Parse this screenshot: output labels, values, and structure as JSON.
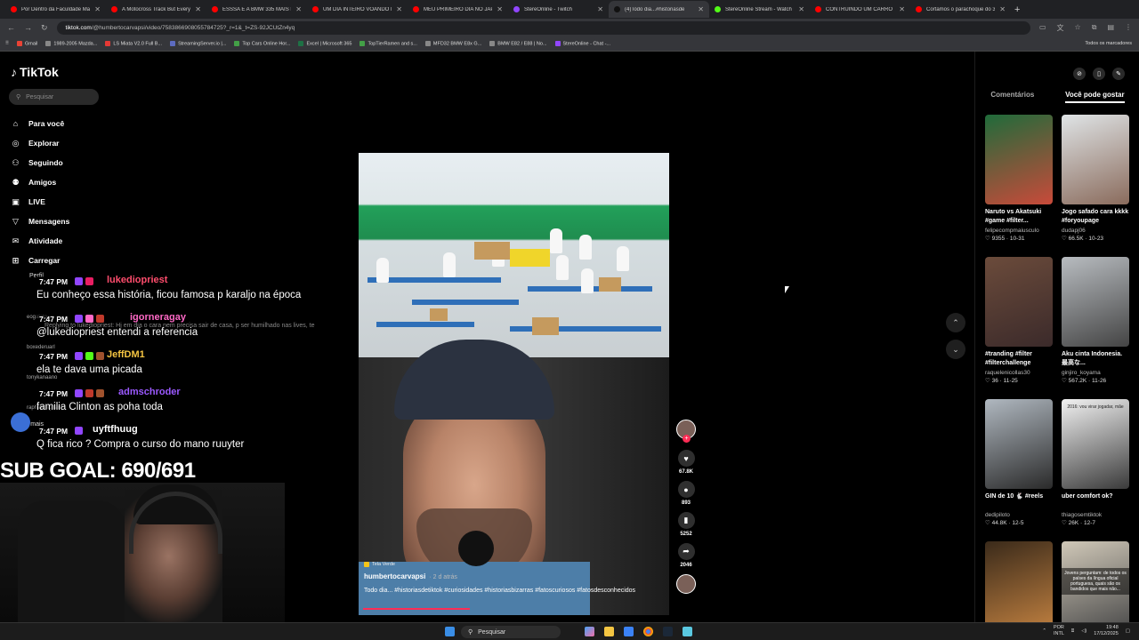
{
  "browser": {
    "tabs": [
      {
        "title": "Por Dentro da Faculdade Mai",
        "color": "#ff0000",
        "active": false
      },
      {
        "title": "A Motocross Track But Every",
        "color": "#ff0000",
        "active": false
      },
      {
        "title": "ESSSA É A BMW 335 MAIS LI",
        "color": "#ff0000",
        "active": false
      },
      {
        "title": "UM DIA INTEIRO VOANDO PI",
        "color": "#ff0000",
        "active": false
      },
      {
        "title": "MEU PRIMEIRO DIA NO JAPÃ",
        "color": "#ff0000",
        "active": false
      },
      {
        "title": "StereOnline - Twitch",
        "color": "#9146ff",
        "active": false
      },
      {
        "title": "(4)Todo dia...#historiasde",
        "color": "#111111",
        "active": true
      },
      {
        "title": "StereOnline Stream - Watch L",
        "color": "#53fc18",
        "active": false
      },
      {
        "title": "CONTRUINDO UM CARRO E",
        "color": "#ff0000",
        "active": false
      },
      {
        "title": "Cortamos o parachoque do 3",
        "color": "#ff0000",
        "active": false
      }
    ],
    "url_host": "tiktok.com",
    "url_path": "/@humbertocarvapsi/video/7583866908055784725?_r=1&_t=ZS-92JCUtZn4yq",
    "bookmarks": [
      {
        "label": "Gmail",
        "color": "#ea4335"
      },
      {
        "label": "1989-2005 Mazda...",
        "color": "#888888"
      },
      {
        "label": "LS Miata V2.0 Full B...",
        "color": "#e53935"
      },
      {
        "label": "StreamingServer.io |...",
        "color": "#5c6bc0"
      },
      {
        "label": "Top Cars Online Hor...",
        "color": "#43a047"
      },
      {
        "label": "Excel | Microsoft 365",
        "color": "#1e7145"
      },
      {
        "label": "TopTierRamen and s...",
        "color": "#43a047"
      },
      {
        "label": "MFD32 BMW E8x G...",
        "color": "#888888"
      },
      {
        "label": "BMW E82 / E88 | No...",
        "color": "#888888"
      },
      {
        "label": "StereOnline - Chat -...",
        "color": "#9146ff"
      }
    ],
    "all_bookmarks": "Todos os marcadores"
  },
  "tiktok": {
    "logo": "TikTok",
    "search_placeholder": "Pesquisar",
    "nav": [
      {
        "label": "Para você",
        "icon": "home-icon",
        "glyph": "⌂"
      },
      {
        "label": "Explorar",
        "icon": "compass-icon",
        "glyph": "◎"
      },
      {
        "label": "Seguindo",
        "icon": "following-icon",
        "glyph": "⚇"
      },
      {
        "label": "Amigos",
        "icon": "friends-icon",
        "glyph": "⚉"
      },
      {
        "label": "LIVE",
        "icon": "live-icon",
        "glyph": "▣"
      },
      {
        "label": "Mensagens",
        "icon": "messages-icon",
        "glyph": "▽"
      },
      {
        "label": "Atividade",
        "icon": "activity-icon",
        "glyph": "✉"
      },
      {
        "label": "Carregar",
        "icon": "upload-icon",
        "glyph": "⊞"
      }
    ],
    "perfil": "Perfil",
    "follow_list": [
      "eogalato",
      "boxederuarl",
      "tonykanaano",
      "raphaelbigham"
    ],
    "ver_mais": "Ver mais",
    "video": {
      "tag": "Tela Verde",
      "author": "humbertocarvapsi",
      "age": "· 2 d atrás",
      "caption": "Todo dia... #historiasdetiktok #curiosidades #historiasbizarras #fatoscuriosos #fatosdesconhecidos"
    },
    "actions": {
      "likes": "67.8K",
      "comments": "893",
      "saves": "5252",
      "shares": "2046"
    },
    "right_tabs": [
      "Comentários",
      "Você pode gostar"
    ],
    "suggestions": [
      {
        "title": "Naruto vs Akatsuki #game #filter...",
        "author": "felipecompmaiusculo",
        "views": "9355",
        "date": "10-31",
        "colors": [
          "#1f6b3a",
          "#c94a3a"
        ]
      },
      {
        "title": "Jogo safado cara kkkk #foryoupage",
        "author": "dudapj06",
        "views": "66.5K",
        "date": "10-23",
        "colors": [
          "#dfe4e6",
          "#8a6b5c"
        ]
      },
      {
        "title": "#tranding #filter #filterchallenge",
        "author": "raquelenicollas30",
        "views": "36",
        "date": "11-25",
        "colors": [
          "#6b4b3b",
          "#3b2a2a"
        ]
      },
      {
        "title": "Aku cinta Indonesia. 最高な...",
        "author": "ginjiro_koyama",
        "views": "567.2K",
        "date": "11-26",
        "colors": [
          "#b8bcc0",
          "#444444"
        ]
      },
      {
        "title": "GIN de 10 🐇 #reels",
        "author": "dedipiloto",
        "views": "44.8K",
        "date": "12-5",
        "colors": [
          "#b0b8c0",
          "#2a2a2a"
        ]
      },
      {
        "title": "uber comfort ok?",
        "author": "thiagosemtiktok",
        "views": "26K",
        "date": "12-7",
        "colors": [
          "#f2f2f2",
          "#3a3a3a"
        ]
      },
      {
        "title": "",
        "author": "",
        "views": "",
        "date": "",
        "colors": [
          "#3a2a1a",
          "#c08040"
        ]
      },
      {
        "title": "",
        "author": "",
        "views": "",
        "date": "",
        "colors": [
          "#d0c8b8",
          "#4a4a4a"
        ]
      }
    ],
    "suggestion_overlay_1": "2016: vou virar jogadar, mãe",
    "suggestion_overlay_2": "Jovens perguntam: de todos os países da língua oficial portuguesa, quais são os bandidos que mais não..."
  },
  "stream": {
    "sub_goal": "SUB GOAL: 690/691",
    "messages": [
      {
        "time": "7:47 PM",
        "user": "lukediopriest",
        "color": "#ff4d6d",
        "text": "Eu conheço essa história, ficou famosa p karaljo na época",
        "reply": ""
      },
      {
        "time": "7:47 PM",
        "user": "igorneragay",
        "color": "#ff69c6",
        "text": "@lukediopriest entendi a referencia",
        "reply": "Replying to lukediopriest: Hj em dia o cara nem precisa sair de casa, p ser humilhado nas lives, te"
      },
      {
        "time": "7:47 PM",
        "user": "JeffDM1",
        "color": "#f5c542",
        "text": "ela te dava uma picada",
        "reply": ""
      },
      {
        "time": "7:47 PM",
        "user": "admschroder",
        "color": "#9b59ff",
        "text": "familia Clinton as poha toda",
        "reply": ""
      },
      {
        "time": "7:47 PM",
        "user": "uyftfhuug",
        "color": "#ffffff",
        "text": "Q fica rico ? Compra o curso do mano ruuyter",
        "reply": ""
      }
    ]
  },
  "taskbar": {
    "search": "Pesquisar",
    "lang": "POR",
    "lang2": "INTL",
    "time": "19:48",
    "date": "17/12/2025"
  }
}
